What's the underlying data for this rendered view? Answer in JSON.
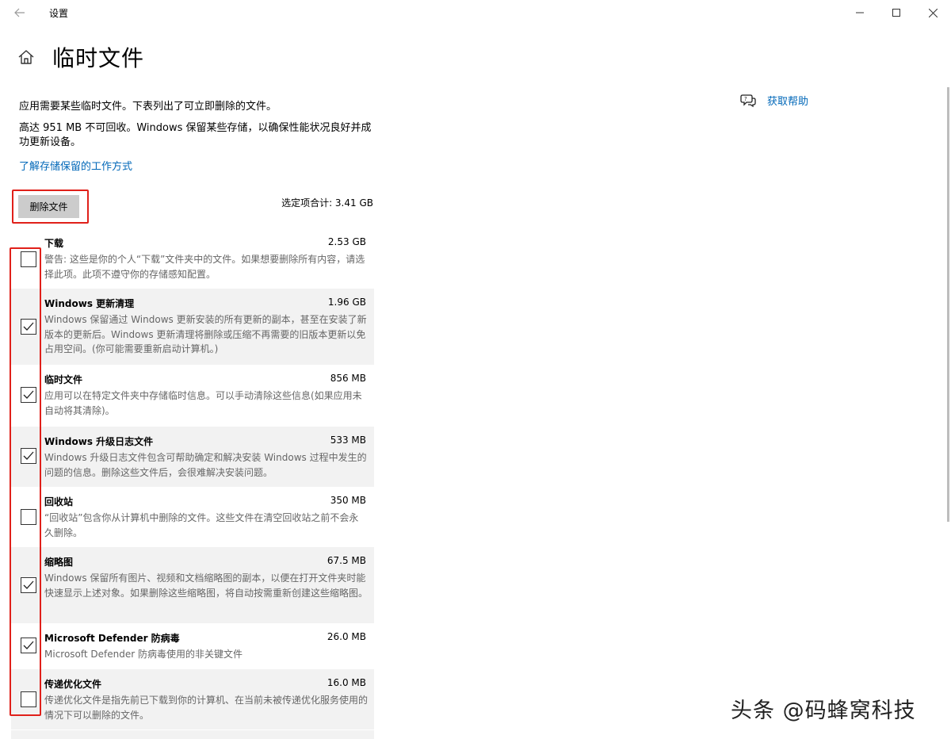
{
  "window": {
    "app_title": "设置",
    "back_icon": "arrow-left-icon",
    "controls": [
      "minimize-icon",
      "maximize-icon",
      "close-icon"
    ]
  },
  "page": {
    "title": "临时文件",
    "home_icon": "home-icon",
    "intro": "应用需要某些临时文件。下表列出了可立即删除的文件。",
    "intro2": "高达 951 MB 不可回收。Windows 保留某些存储，以确保性能状况良好并成功更新设备。",
    "learn_link": "了解存储保留的工作方式",
    "delete_button": "删除文件",
    "total": "选定项合计: 3.41 GB"
  },
  "help": {
    "label": "获取帮助",
    "icon": "chat-help-icon"
  },
  "items": [
    {
      "name": "下载",
      "size": "2.53 GB",
      "checked": false,
      "desc": "警告: 这些是你的个人“下载”文件夹中的文件。如果想要删除所有内容，请选择此项。此项不遵守你的存储感知配置。"
    },
    {
      "name": "Windows 更新清理",
      "size": "1.96 GB",
      "checked": true,
      "desc": "Windows 保留通过 Windows 更新安装的所有更新的副本，甚至在安装了新版本的更新后。Windows 更新清理将删除或压缩不再需要的旧版本更新以免占用空间。(你可能需要重新启动计算机。)"
    },
    {
      "name": "临时文件",
      "size": "856 MB",
      "checked": true,
      "desc": "应用可以在特定文件夹中存储临时信息。可以手动清除这些信息(如果应用未自动将其清除)。"
    },
    {
      "name": "Windows 升级日志文件",
      "size": "533 MB",
      "checked": true,
      "desc": "Windows 升级日志文件包含可帮助确定和解决安装 Windows 过程中发生的问题的信息。删除这些文件后，会很难解决安装问题。"
    },
    {
      "name": "回收站",
      "size": "350 MB",
      "checked": false,
      "desc": "“回收站”包含你从计算机中删除的文件。这些文件在清空回收站之前不会永久删除。"
    },
    {
      "name": "缩略图",
      "size": "67.5 MB",
      "checked": true,
      "desc": "Windows 保留所有图片、视频和文档缩略图的副本，以便在打开文件夹时能快速显示上述对象。如果删除这些缩略图，将自动按需重新创建这些缩略图。"
    },
    {
      "name": "Microsoft Defender 防病毒",
      "size": "26.0 MB",
      "checked": true,
      "desc": "Microsoft Defender 防病毒使用的非关键文件"
    },
    {
      "name": "传递优化文件",
      "size": "16.0 MB",
      "checked": false,
      "desc": "传递优化文件是指先前已下载到你的计算机、在当前未被传递优化服务使用的情况下可以删除的文件。"
    }
  ],
  "watermark": "头条 @码蜂窝科技",
  "colors": {
    "accent": "#0067b8",
    "highlight": "#e0201a"
  }
}
